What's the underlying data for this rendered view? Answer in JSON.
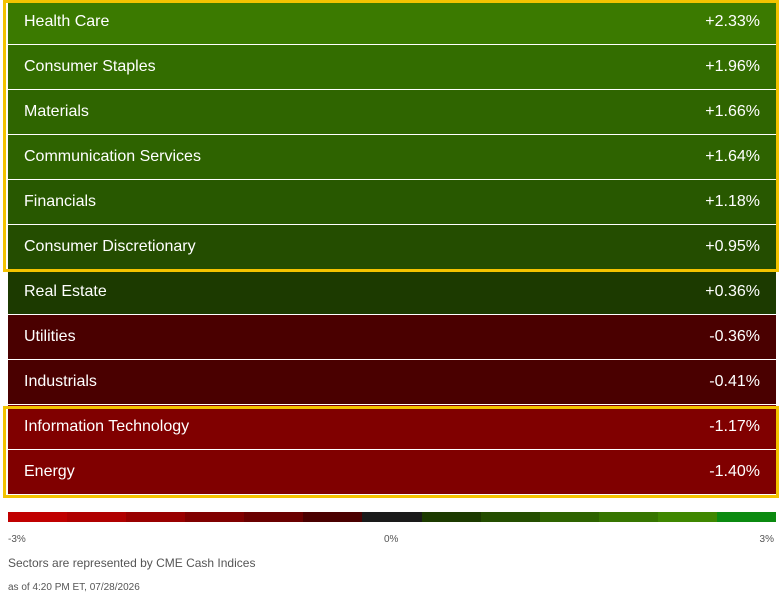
{
  "chart_data": {
    "type": "table",
    "categories": [
      "Health Care",
      "Consumer Staples",
      "Materials",
      "Communication Services",
      "Financials",
      "Consumer Discretionary",
      "Real Estate",
      "Utilities",
      "Industrials",
      "Information Technology",
      "Energy"
    ],
    "values": [
      2.33,
      1.96,
      1.66,
      1.64,
      1.18,
      0.95,
      0.36,
      -0.36,
      -0.41,
      -1.17,
      -1.4
    ],
    "value_labels": [
      "+2.33%",
      "+1.96%",
      "+1.66%",
      "+1.64%",
      "+1.18%",
      "+0.95%",
      "+0.36%",
      "-0.36%",
      "-0.41%",
      "-1.17%",
      "-1.40%"
    ],
    "scale": {
      "min_label": "-3%",
      "mid_label": "0%",
      "max_label": "3%",
      "range": [
        -3,
        3
      ],
      "colors": [
        "#c00000",
        "#b00000",
        "#990000",
        "#800000",
        "#6a0000",
        "#4a0000",
        "#1a1a1a",
        "#1c3a00",
        "#244d00",
        "#2e6300",
        "#367500",
        "#3f8700",
        "#0b8a10"
      ]
    },
    "row_colors": [
      "#3b7a00",
      "#336d00",
      "#2f6500",
      "#2e6300",
      "#285800",
      "#244d00",
      "#1c3a00",
      "#4a0000",
      "#4a0000",
      "#800000",
      "#800000"
    ],
    "highlight_groups": [
      [
        0,
        5
      ],
      [
        9,
        10
      ]
    ],
    "highlight_color": "#f3c300"
  },
  "notes": {
    "source": "Sectors are represented by CME Cash Indices",
    "timestamp": "as of 4:20 PM ET, 07/28/2026"
  }
}
